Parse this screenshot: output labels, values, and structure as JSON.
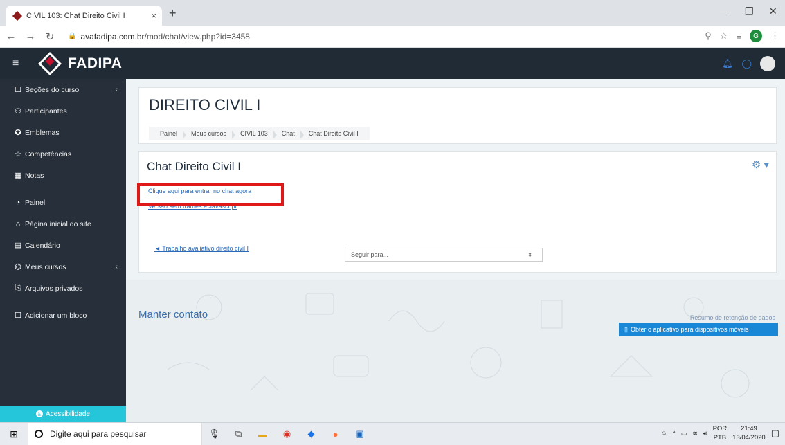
{
  "browser": {
    "tab_title": "CIVIL 103: Chat Direito Civil I",
    "tab_close": "×",
    "new_tab": "+",
    "url_host": "avafadipa.com.br",
    "url_path": "/mod/chat/view.php?id=3458",
    "profile_letter": "G"
  },
  "navbar": {
    "brand": "FADIPA"
  },
  "sidebar": {
    "items": [
      {
        "label": "Seções do curso"
      },
      {
        "label": "Participantes"
      },
      {
        "label": "Emblemas"
      },
      {
        "label": "Competências"
      },
      {
        "label": "Notas"
      },
      {
        "label": "Painel"
      },
      {
        "label": "Página inicial do site"
      },
      {
        "label": "Calendário"
      },
      {
        "label": "Meus cursos"
      },
      {
        "label": "Arquivos privados"
      },
      {
        "label": "Adicionar um bloco"
      }
    ],
    "accessibility": "Acessibilidade"
  },
  "header": {
    "course_title": "DIREITO CIVIL I",
    "breadcrumb": [
      "Painel",
      "Meus cursos",
      "CIVIL 103",
      "Chat",
      "Chat Direito Civil I"
    ]
  },
  "activity": {
    "title": "Chat Direito Civil I",
    "enter_link": "Clique aqui para entrar no chat agora",
    "noframes_link": "Versão sem frames e Javascript",
    "prev_link": "◄ Trabalho avaliativo direito civil I",
    "jump_placeholder": "Seguir para..."
  },
  "footer": {
    "title": "Manter contato",
    "data_retention": "Resumo de retenção de dados",
    "mobile_app": "Obter o aplicativo para dispositivos móveis"
  },
  "taskbar": {
    "search_placeholder": "Digite aqui para pesquisar",
    "lang_top": "POR",
    "lang_bottom": "PTB",
    "time": "21:49",
    "date": "13/04/2020"
  }
}
